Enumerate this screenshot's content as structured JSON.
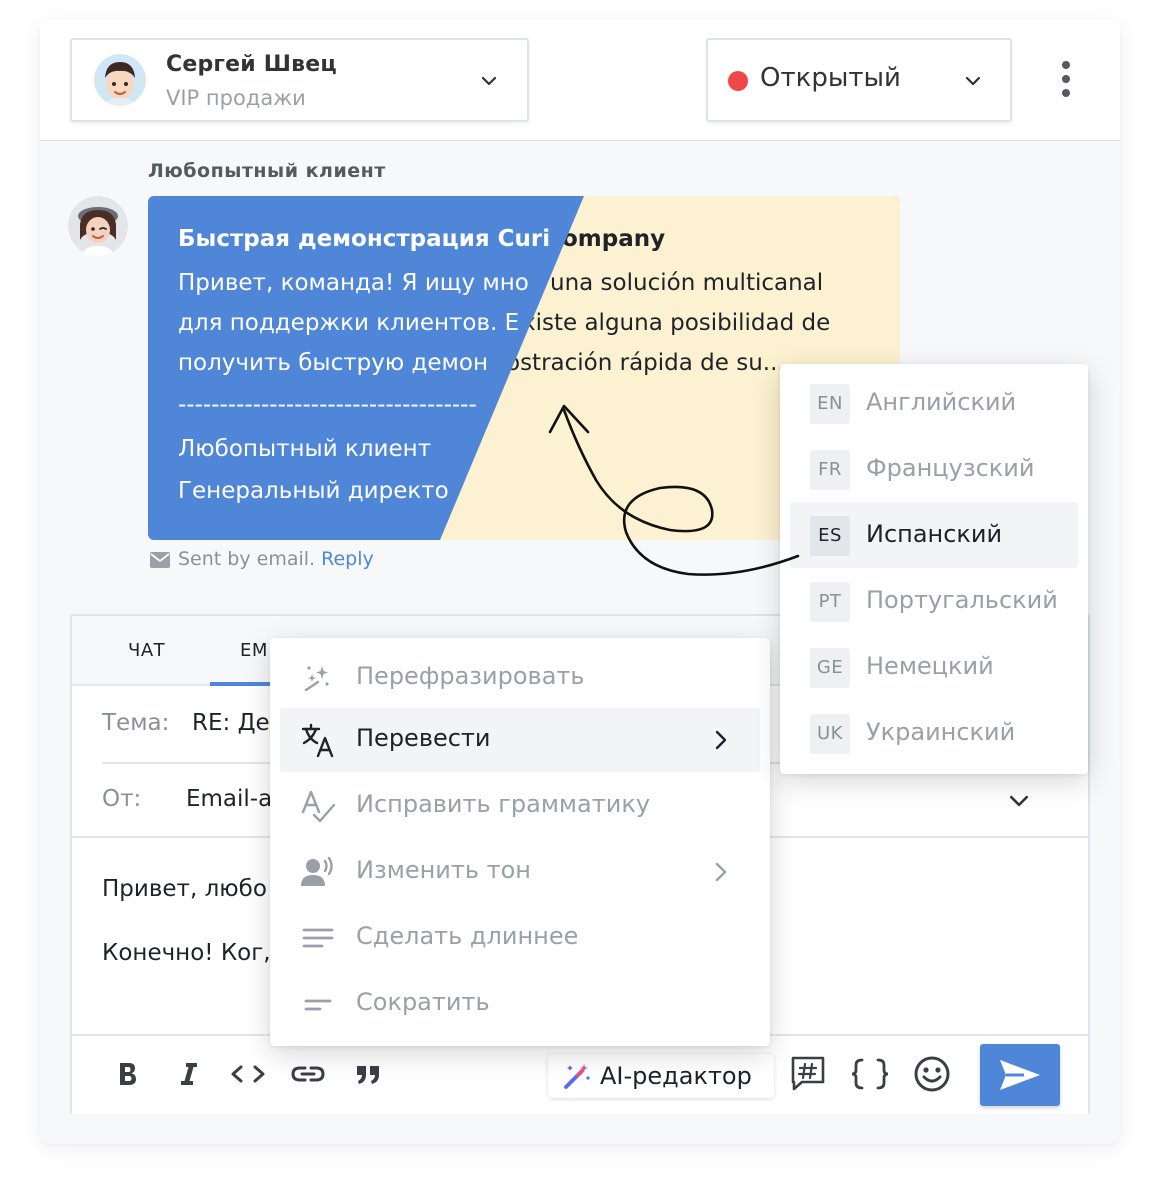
{
  "header": {
    "agent": {
      "name": "Сергей Швец",
      "team": "VIP продажи"
    },
    "status": {
      "label": "Открытый",
      "color": "#f04848"
    }
  },
  "message": {
    "sender": "Любопытный клиент",
    "original": {
      "title": "Быстрая демонстрация Curi",
      "lines": [
        "Привет, команда! Я ищу мно",
        "для поддержки клиентов. Е",
        "получить быструю демон",
        "------------------------------------",
        "Любопытный клиент",
        "Генеральный директо"
      ]
    },
    "translated": {
      "title": "ompany",
      "lines": [
        "una solución multicanal",
        "xiste alguna posibilidad de",
        "ostración rápida de su...",
        "",
        "",
        ""
      ]
    },
    "meta": {
      "sent_by": "Sent by email.",
      "reply": "Reply"
    }
  },
  "composer": {
    "tabs": [
      {
        "label": "ЧАТ"
      },
      {
        "label": "EM"
      }
    ],
    "subject_label": "Тема:",
    "subject_value": "RE: Де",
    "from_label": "От:",
    "from_value": "Email-a",
    "body": [
      "Привет, любо",
      "Конечно! Ког,"
    ],
    "ai_editor_label": "AI-редактор",
    "accent": "#4f86d8"
  },
  "ai_menu": {
    "items": [
      {
        "label": "Перефразировать",
        "icon": "sparkle-icon",
        "submenu": false
      },
      {
        "label": "Перевести",
        "icon": "translate-icon",
        "submenu": true,
        "active": true
      },
      {
        "label": "Исправить грамматику",
        "icon": "grammar-check-icon",
        "submenu": false
      },
      {
        "label": "Изменить тон",
        "icon": "voice-tone-icon",
        "submenu": true
      },
      {
        "label": "Сделать длиннее",
        "icon": "lines-long-icon",
        "submenu": false
      },
      {
        "label": "Сократить",
        "icon": "lines-short-icon",
        "submenu": false
      }
    ]
  },
  "languages": {
    "items": [
      {
        "code": "EN",
        "label": "Английский"
      },
      {
        "code": "FR",
        "label": "Французский"
      },
      {
        "code": "ES",
        "label": "Испанский",
        "active": true
      },
      {
        "code": "PT",
        "label": "Португальский"
      },
      {
        "code": "GE",
        "label": "Немецкий"
      },
      {
        "code": "UK",
        "label": "Украинский"
      }
    ]
  }
}
